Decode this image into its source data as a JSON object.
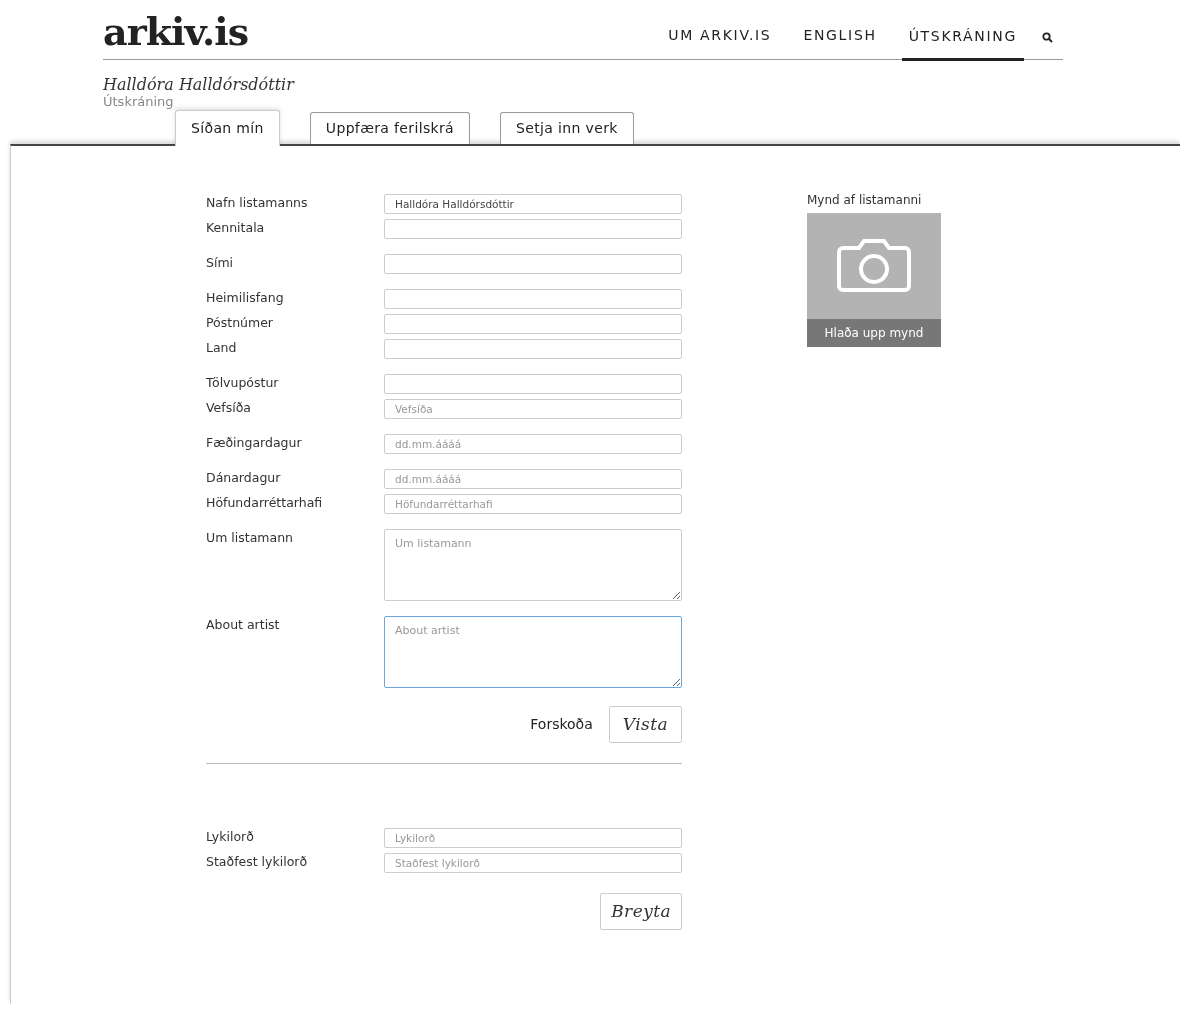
{
  "logo": "arkiv.is",
  "nav": [
    {
      "label": "UM ARKIV.IS",
      "selected": false
    },
    {
      "label": "ENGLISH",
      "selected": false
    },
    {
      "label": "ÚTSKRÁNING",
      "selected": true
    }
  ],
  "user": {
    "name": "Halldóra Halldórsdóttir",
    "logout": "Útskráning"
  },
  "tabs": [
    {
      "label": "Síðan mín",
      "selected": true
    },
    {
      "label": "Uppfæra ferilskrá",
      "selected": false
    },
    {
      "label": "Setja inn verk",
      "selected": false
    }
  ],
  "profile_groups": [
    {
      "fields": [
        {
          "label": "Nafn listamanns",
          "kind": "input",
          "value": "Halldóra Halldórsdóttir"
        },
        {
          "label": "Kennitala",
          "kind": "input"
        }
      ]
    },
    {
      "fields": [
        {
          "label": "Sími",
          "kind": "input"
        }
      ]
    },
    {
      "fields": [
        {
          "label": "Heimilisfang",
          "kind": "input"
        },
        {
          "label": "Póstnúmer",
          "kind": "input"
        },
        {
          "label": "Land",
          "kind": "input"
        }
      ]
    },
    {
      "fields": [
        {
          "label": "Tölvupóstur",
          "kind": "input"
        },
        {
          "label": "Vefsíða",
          "kind": "input",
          "placeholder": "Vefsíða"
        }
      ]
    },
    {
      "fields": [
        {
          "label": "Fæðingardagur",
          "kind": "input",
          "placeholder": "dd.mm.áááá"
        }
      ]
    },
    {
      "fields": [
        {
          "label": "Dánardagur",
          "kind": "input",
          "placeholder": "dd.mm.áááá"
        },
        {
          "label": "Höfundarréttarhafi",
          "kind": "input",
          "placeholder": "Höfundarréttarhafi"
        }
      ]
    },
    {
      "fields": [
        {
          "label": "Um listamann",
          "kind": "textarea",
          "placeholder": "Um listamann",
          "focused": false
        }
      ]
    },
    {
      "fields": [
        {
          "label": "About artist",
          "kind": "textarea",
          "placeholder": "About artist",
          "focused": true
        }
      ]
    }
  ],
  "preview_link": "Forskoða",
  "save_button": "Vista",
  "password_fields": [
    {
      "label": "Lykilorð",
      "kind": "input",
      "placeholder": "Lykilorð"
    },
    {
      "label": "Staðfest lykilorð",
      "kind": "input",
      "placeholder": "Staðfest lykilorð"
    }
  ],
  "change_button": "Breyta",
  "photo": {
    "label": "Mynd af listamanni",
    "upload": "Hlaða upp mynd"
  }
}
